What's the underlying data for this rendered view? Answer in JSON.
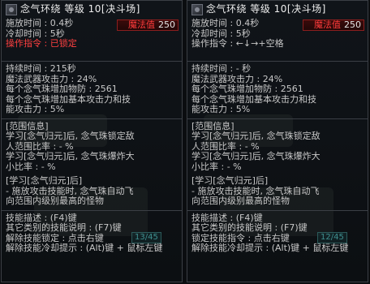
{
  "panels": [
    {
      "id": "left",
      "title": "念气环绕 等级 10[决斗场]",
      "cast_time": "施放时间 : 0.4秒",
      "cooldown": "冷却时间 : 5秒",
      "command": "操作指令 : 已锁定",
      "mp_label": "魔法值",
      "mp_value": "250",
      "stats": [
        "持续时间 : 215秒",
        "魔法武器攻击力 : 24%",
        "每个念气珠增加物防 : 2561",
        "每个念气珠增加基本攻击力和技",
        "能攻击力 : 5%"
      ],
      "range_title": "[范围信息]",
      "range": [
        "学习[念气归元]后, 念气珠锁定敌",
        "人范围比率 : - %",
        "学习[念气归元]后, 念气珠爆炸大",
        "小比率 : - %"
      ],
      "learn_title": "[学习[念气归元]后]",
      "learn": [
        "- 施放攻击技能时, 念气珠自动飞",
        "向范围内级别最高的怪物"
      ],
      "hints": [
        "技能描述 : (F4)键",
        "其它类别的技能说明 : (F7)键",
        "解除技能锁定 : 点击右键",
        "解除技能冷却提示 : (Alt)键 + 鼠标左键"
      ],
      "bg_slot": "13/45"
    },
    {
      "id": "right",
      "title": "念气环绕 等级 10[决斗场]",
      "cast_time": "施放时间 : 0.4秒",
      "cooldown": "冷却时间 : 5秒",
      "command": "操作指令 : ←↓→+空格",
      "mp_label": "魔法值",
      "mp_value": "250",
      "stats": [
        "持续时间 : - 秒",
        "魔法武器攻击力 : 24%",
        "每个念气珠增加物防 : 2561",
        "每个念气珠增加基本攻击力和技",
        "能攻击力 : 5%"
      ],
      "range_title": "[范围信息]",
      "range": [
        "学习[念气归元]后, 念气珠锁定敌",
        "人范围比率 : - %",
        "学习[念气归元]后, 念气珠爆炸大",
        "小比率 : - %"
      ],
      "learn_title": "[学习[念气归元]后]",
      "learn": [
        "- 施放攻击技能时, 念气珠自动飞",
        "向范围内级别最高的怪物"
      ],
      "hints": [
        "技能描述 : (F4)键",
        "其它类别的技能说明 : (F7)键",
        "锁定技能指令 : 点击右键",
        "解除技能冷却提示 : (Alt)键 + 鼠标左键"
      ],
      "bg_slot": "12/45"
    }
  ],
  "colors": {
    "accent_red": "#ff4040",
    "mp_border": "#8b1e1e",
    "panel_border": "#3b3f45"
  }
}
